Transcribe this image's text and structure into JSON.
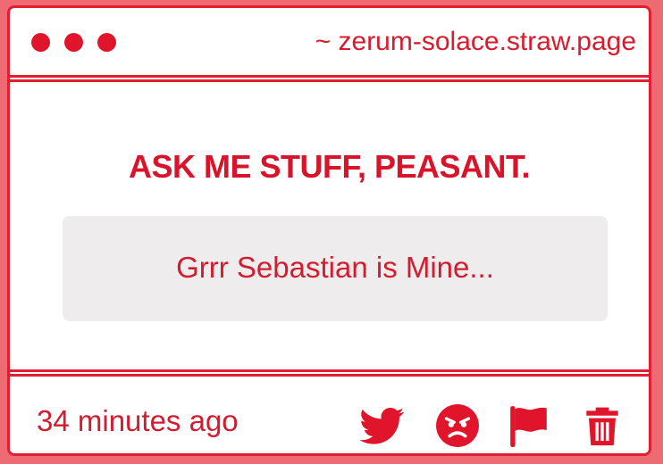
{
  "window": {
    "url": "~ zerum-solace.straw.page"
  },
  "main": {
    "heading": "ASK ME STUFF, PEASANT.",
    "question": "Grrr Sebastian is Mine..."
  },
  "footer": {
    "timestamp": "34 minutes ago",
    "actions": [
      {
        "icon": "twitter-icon"
      },
      {
        "icon": "angry-face-icon"
      },
      {
        "icon": "flag-icon"
      },
      {
        "icon": "trash-icon"
      }
    ]
  },
  "colors": {
    "accent": "#e21f32",
    "background": "#ee6b74",
    "question_box": "#eeecec"
  }
}
